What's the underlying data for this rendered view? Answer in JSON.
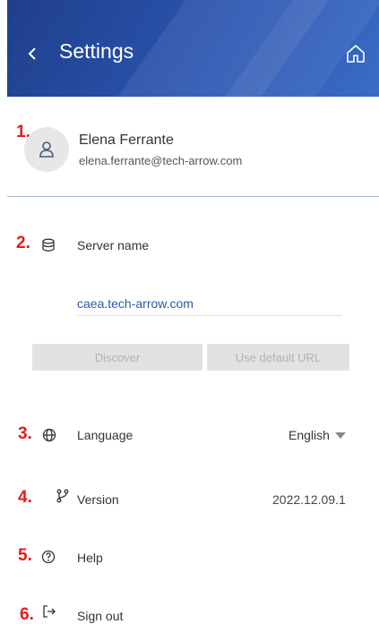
{
  "header": {
    "title": "Settings",
    "back_icon": "chevron-left-icon",
    "home_icon": "home-icon"
  },
  "user": {
    "name": "Elena Ferrante",
    "email": "elena.ferrante@tech-arrow.com",
    "avatar_icon": "person-icon"
  },
  "markers": [
    "1.",
    "2.",
    "3.",
    "4.",
    "5.",
    "6."
  ],
  "server": {
    "label": "Server name",
    "icon": "database-icon",
    "value": "caea.tech-arrow.com",
    "discover_label": "Discover",
    "default_url_label": "Use default URL"
  },
  "language": {
    "label": "Language",
    "icon": "globe-icon",
    "selected": "English"
  },
  "version": {
    "label": "Version",
    "icon": "branch-icon",
    "value": "2022.12.09.1"
  },
  "help": {
    "label": "Help",
    "icon": "help-circle-icon"
  },
  "signout": {
    "label": "Sign out",
    "icon": "sign-out-icon"
  },
  "colors": {
    "header": "#2a55b0",
    "marker": "#e21c1c",
    "link": "#2b5aa8"
  }
}
